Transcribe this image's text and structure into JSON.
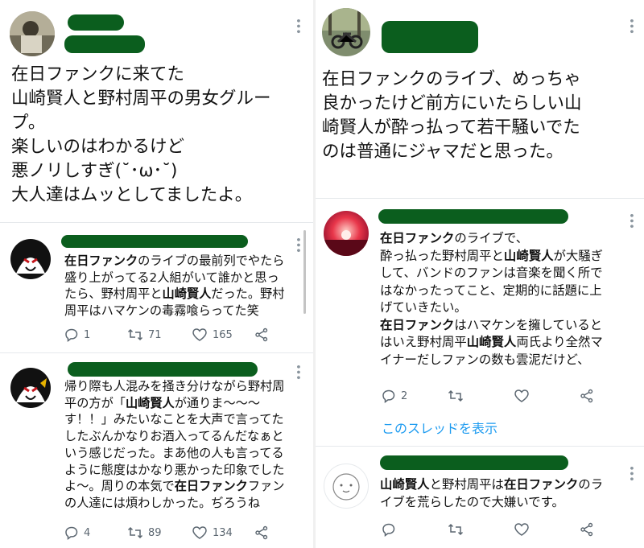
{
  "left": {
    "main_tweet": {
      "text": "在日ファンクに来てた\n山崎賢人と野村周平の男女グルー\nプ。\n楽しいのはわかるけど\n悪ノリしすぎ(˘･ω･˘)\n大人達はムッとしてましたよ。"
    },
    "reply1": {
      "text_parts": [
        "",
        "在日ファンク",
        "のライブの最前列でやたら\n盛り上がってる2人組がいて誰かと思っ\nたら、野村周平と",
        "山崎賢人",
        "だった。野村\n周平はハマケンの毒霧喰らってた笑"
      ],
      "replies": "1",
      "retweets": "71",
      "likes": "165"
    },
    "reply2": {
      "text_parts": [
        "帰り際も人混みを掻き分けながら野村周\n平の方が「",
        "山崎賢人",
        "が通りま〜〜〜\nす！！」みたいなことを大声で言ってた\nしたぶんかなりお酒入ってるんだなぁと\nいう感じだった。まあ他の人も言ってる\nように態度はかなり悪かった印象でした\nよ〜。周りの本気で",
        "在日ファンク",
        "ファン\nの人達には煩わしかった。ぢろうね"
      ],
      "replies": "4",
      "retweets": "89",
      "likes": "134"
    }
  },
  "right": {
    "main_tweet": {
      "text": "在日ファンクのライブ、めっちゃ\n良かったけど前方にいたらしい山\n崎賢人が酔っ払って若干騒いでた\nのは普通にジャマだと思った。"
    },
    "reply1": {
      "text_parts": [
        "",
        "在日ファンク",
        "のライブで、\n酔っ払った野村周平と",
        "山崎賢人",
        "が大騒ぎ\nして、バンドのファンは音楽を聞く所で\nはなかったってこと、定期的に話題に上\nげていきたい。\n",
        "在日ファンク",
        "はハマケンを擁していると\nはいえ野村周平",
        "山崎賢人",
        "両氏より全然マ\nイナーだしファンの数も雲泥だけど、"
      ],
      "replies": "2",
      "show_thread": "このスレッドを表示"
    },
    "reply2": {
      "text_parts": [
        "",
        "山崎賢人",
        "と野村周平は",
        "在日ファンク",
        "のラ\nイブを荒らしたので大嫌いです。"
      ]
    }
  },
  "colors": {
    "accent": "#1d9bf0",
    "redaction": "#0b5e1e",
    "icon_gray": "#5b6670"
  },
  "icons": [
    "more-icon",
    "reply-icon",
    "retweet-icon",
    "like-icon",
    "share-icon"
  ]
}
